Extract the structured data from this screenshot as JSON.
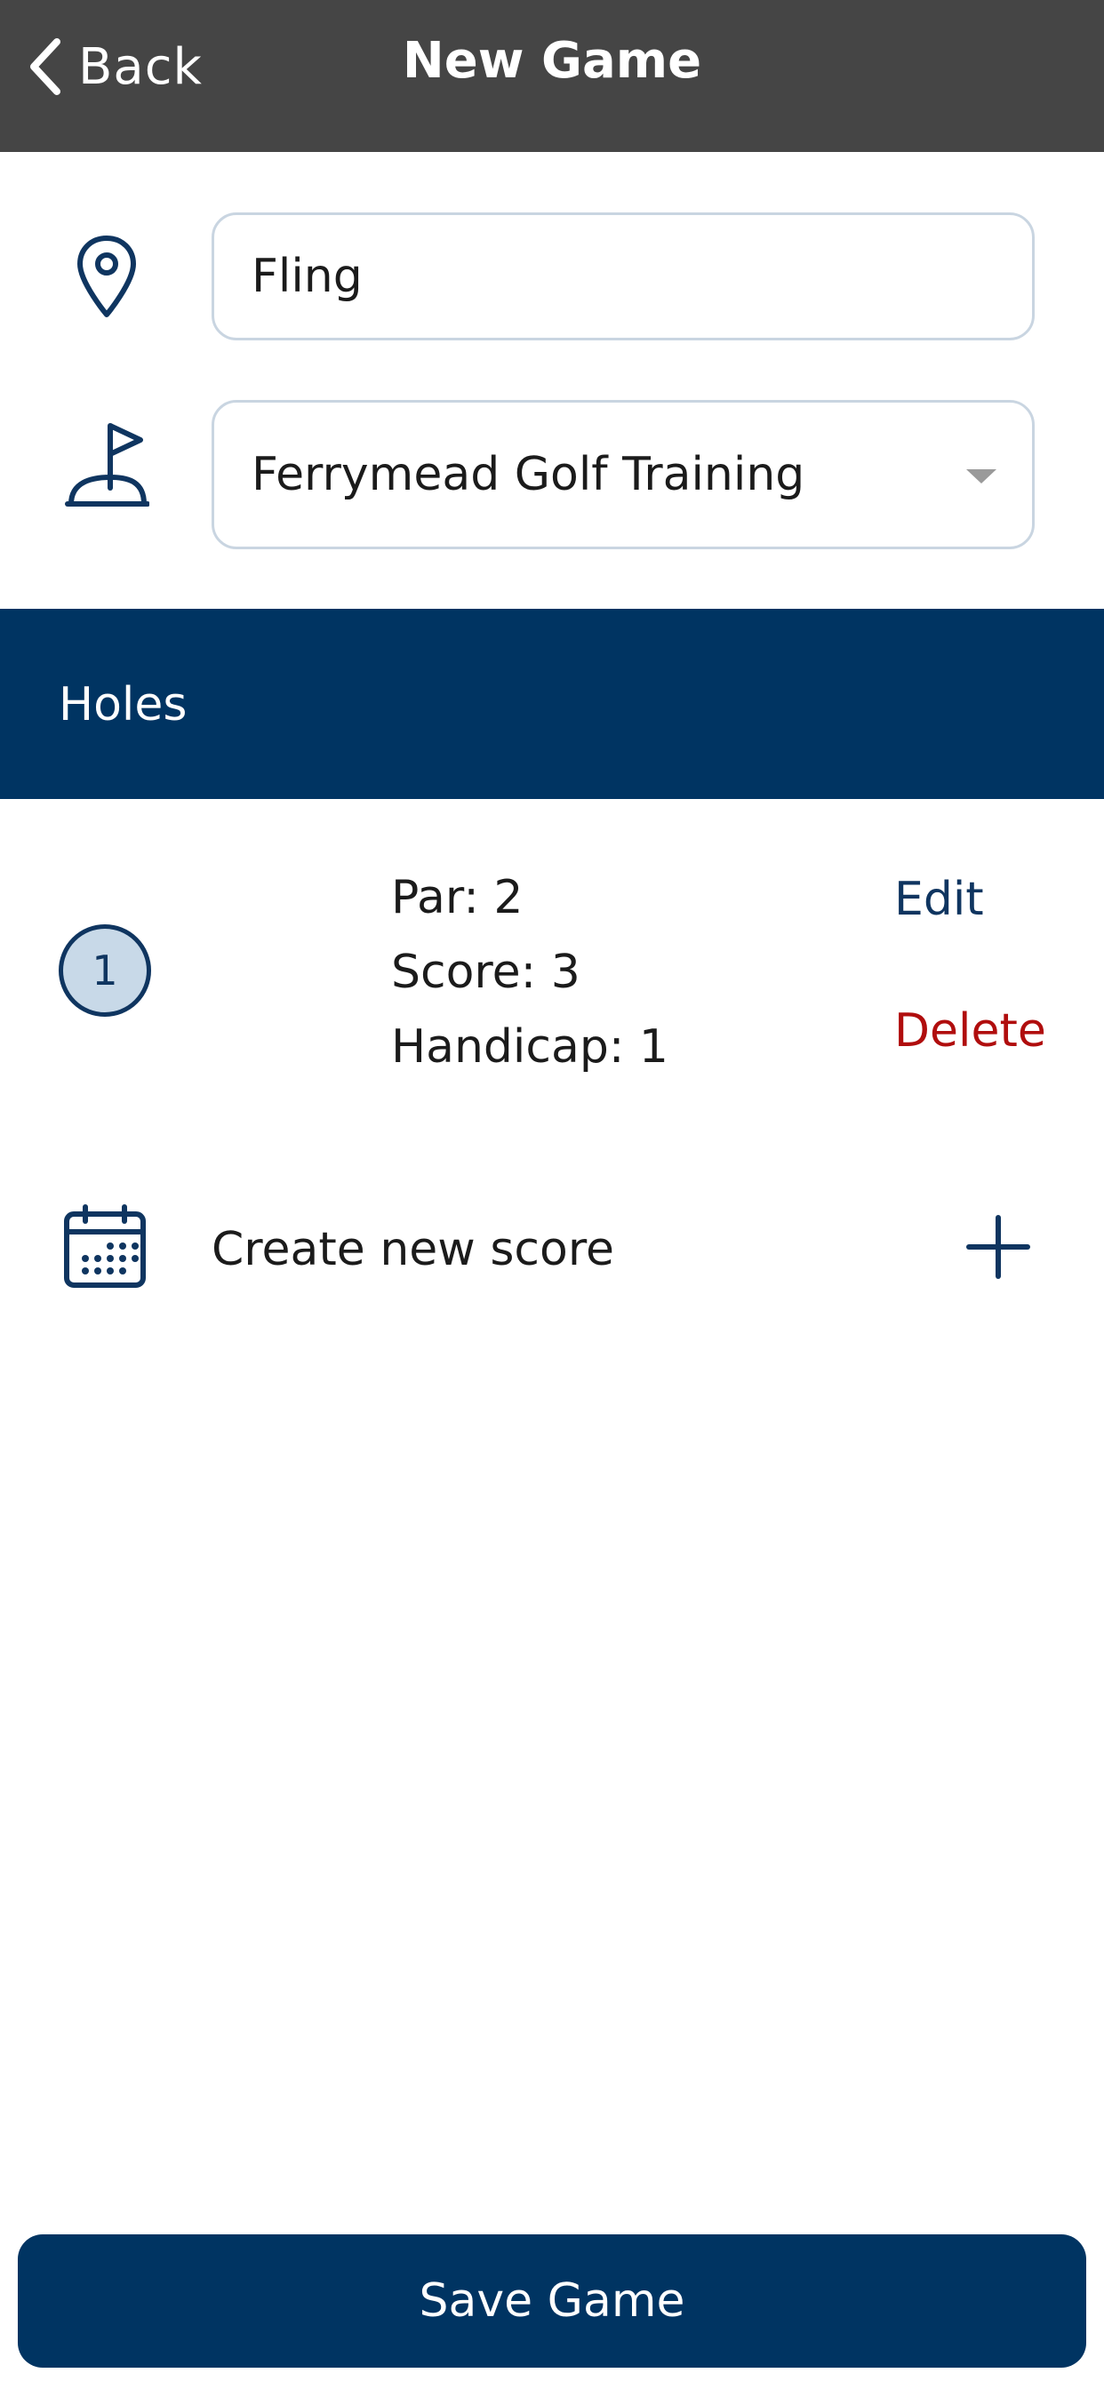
{
  "header": {
    "back_label": "Back",
    "title": "New Game"
  },
  "form": {
    "name_value": "Fling",
    "course_value": "Ferrymead Golf Training"
  },
  "holes": {
    "section_title": "Holes",
    "items": [
      {
        "number": "1",
        "par": "Par: 2",
        "score": "Score: 3",
        "handicap": "Handicap: 1",
        "edit_label": "Edit",
        "delete_label": "Delete"
      }
    ],
    "create_label": "Create new score"
  },
  "footer": {
    "save_label": "Save Game"
  },
  "icons": {
    "back": "chevron-left-icon",
    "location": "map-pin-icon",
    "course": "golf-flag-icon",
    "calendar": "calendar-icon",
    "add": "plus-icon"
  },
  "colors": {
    "header_bg": "#454545",
    "primary": "#003462",
    "danger": "#b00d0d",
    "badge_fill": "#c8d9e8",
    "input_border": "#c9d5e1"
  }
}
